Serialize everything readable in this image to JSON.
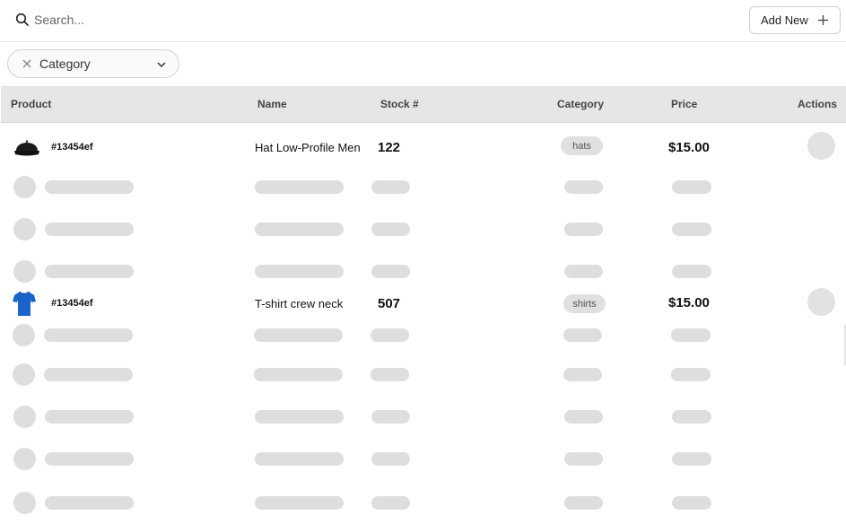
{
  "search": {
    "placeholder": "Search..."
  },
  "toolbar": {
    "add_label": "Add New"
  },
  "filter": {
    "category_label": "Category"
  },
  "table": {
    "headers": {
      "product": "Product",
      "name": "Name",
      "stock": "Stock #",
      "category": "Category",
      "price": "Price",
      "actions": "Actions"
    },
    "rows": [
      {
        "sku": "#13454ef",
        "name": "Hat Low-Profile Men",
        "stock": "122",
        "category": "hats",
        "price": "$15.00",
        "image": "black-cap-icon"
      },
      {
        "sku": "#13454ef",
        "name": "T-shirt crew neck",
        "stock": "507",
        "category": "shirts",
        "price": "$15.00",
        "image": "blue-tshirt-icon"
      }
    ]
  },
  "colors": {
    "header_bg": "#e6e6e6",
    "skeleton": "#dedede",
    "tshirt": "#1a63c9",
    "cap": "#1b1b1b"
  }
}
